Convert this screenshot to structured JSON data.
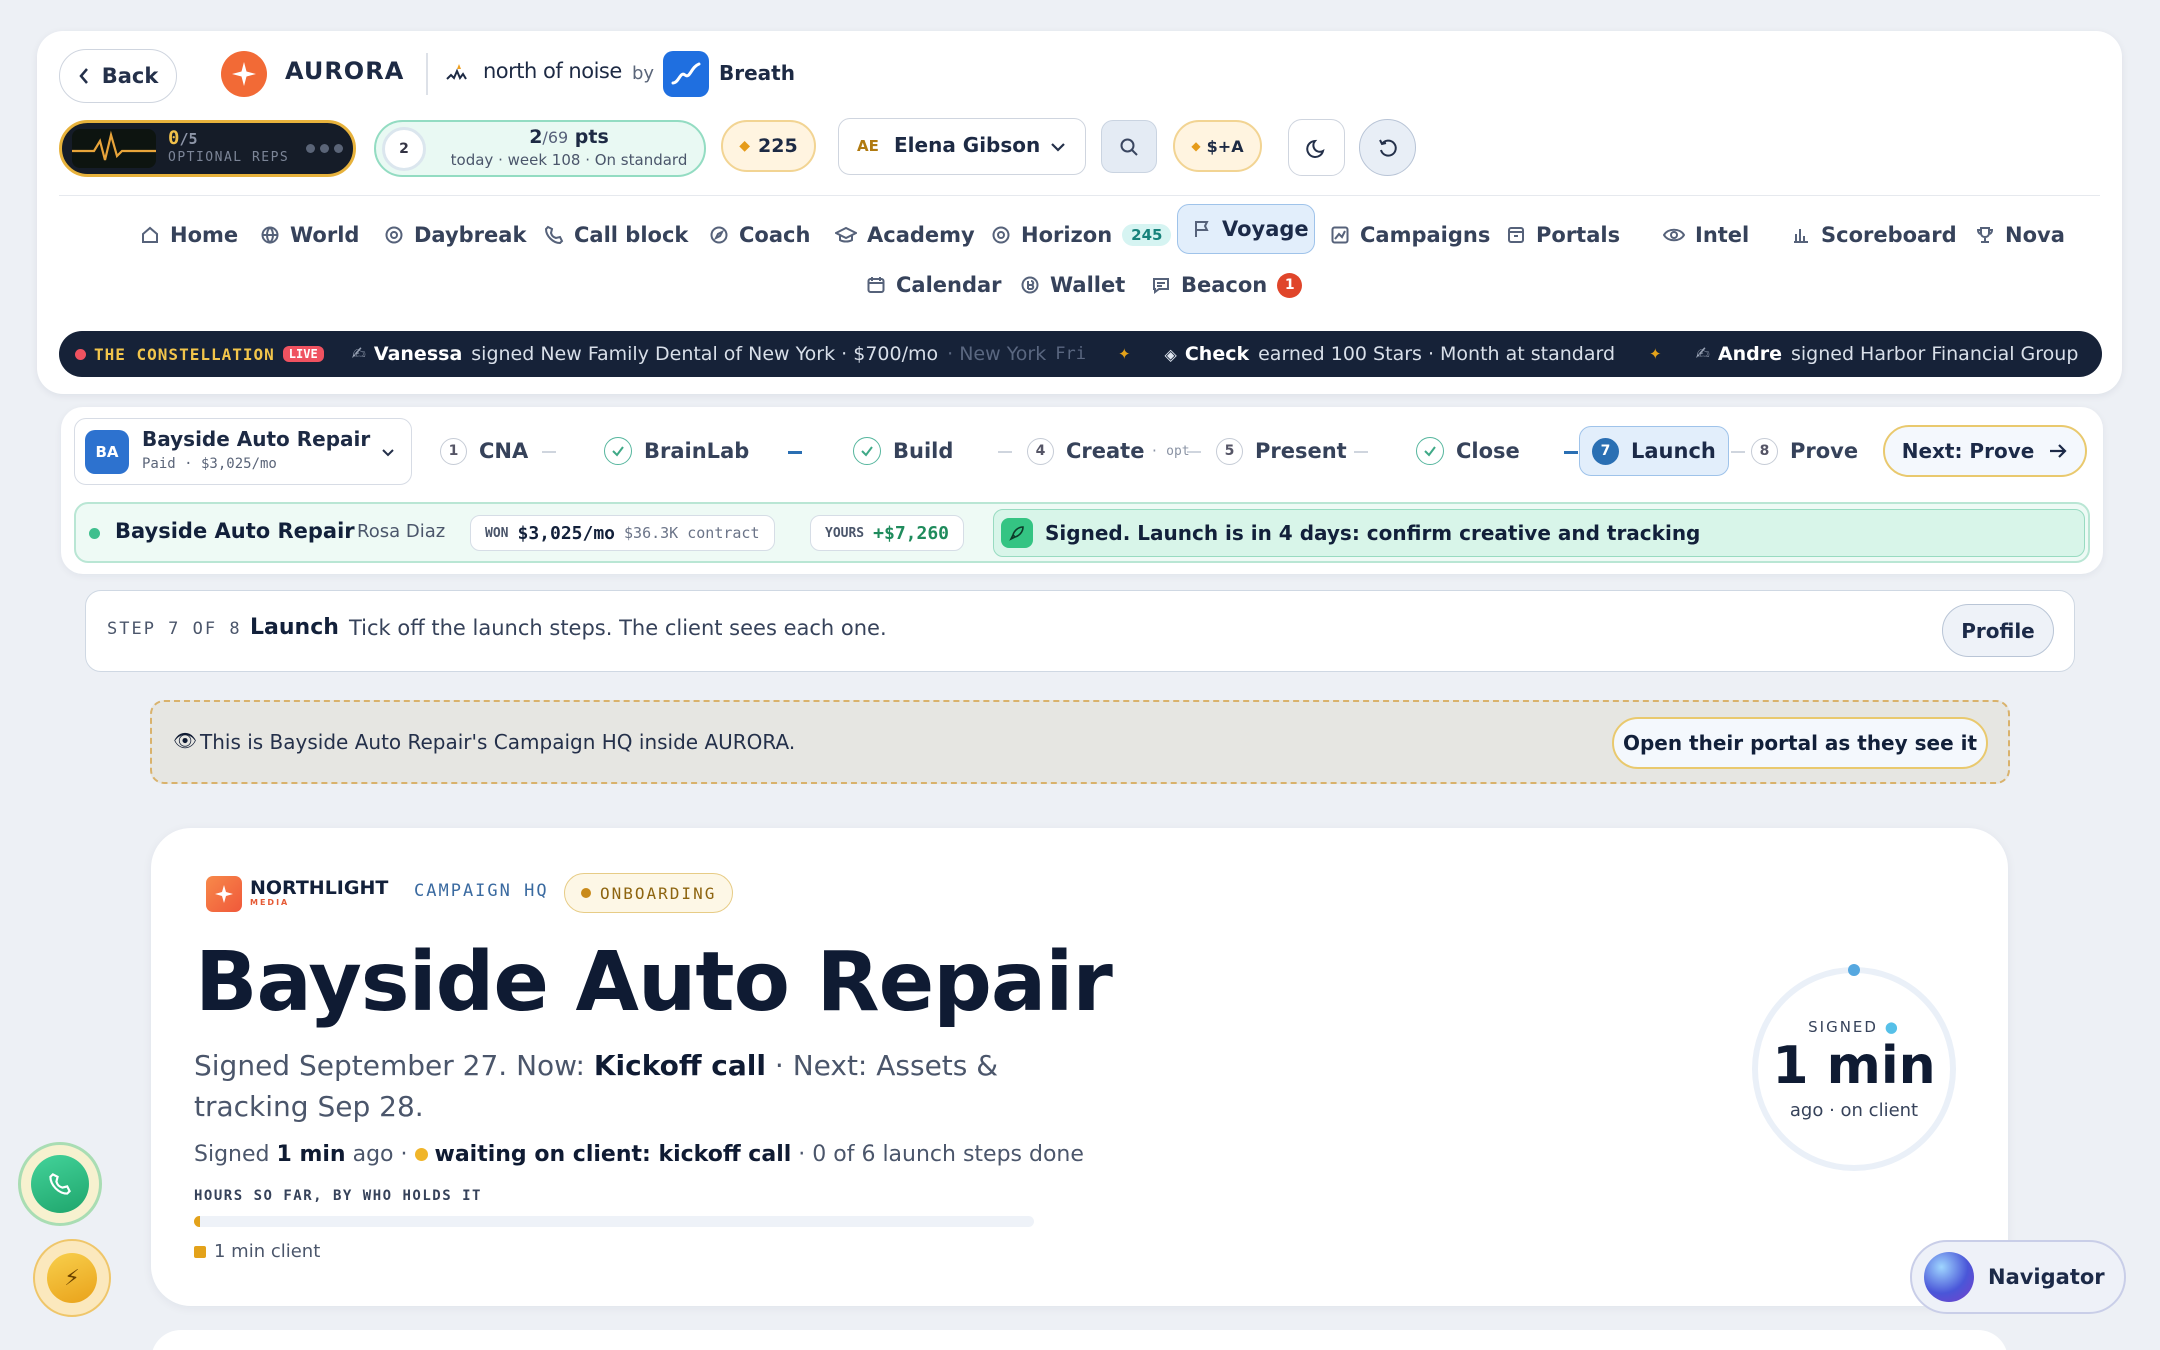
{
  "header": {
    "back_label": "Back",
    "brand_name": "AURORA",
    "partner_name": "north of noise",
    "by_label": "by",
    "breath_label": "Breath",
    "reps_count": "0",
    "reps_total": "/5",
    "reps_label": "OPTIONAL REPS",
    "pts_ring_value": "2",
    "pts_value": "2",
    "pts_total": "/69",
    "pts_unit": "pts",
    "pts_sub": "today · week 108 · On standard",
    "gems": "225",
    "user_initials": "AE",
    "user_name": "Elena Gibson",
    "grade_label": "$+A"
  },
  "nav": {
    "items": [
      {
        "label": "Home"
      },
      {
        "label": "World"
      },
      {
        "label": "Daybreak"
      },
      {
        "label": "Call block"
      },
      {
        "label": "Coach"
      },
      {
        "label": "Academy"
      },
      {
        "label": "Horizon",
        "count": "245"
      },
      {
        "label": "Voyage"
      },
      {
        "label": "Campaigns"
      },
      {
        "label": "Portals"
      },
      {
        "label": "Intel"
      },
      {
        "label": "Scoreboard"
      },
      {
        "label": "Nova"
      },
      {
        "label": "Calendar"
      },
      {
        "label": "Wallet"
      },
      {
        "label": "Beacon",
        "count": "1"
      }
    ]
  },
  "ticker": {
    "title": "THE CONSTELLATION",
    "live": "LIVE",
    "events": [
      {
        "name": "Vanessa",
        "text": "signed New Family Dental of New York · $700/mo",
        "meta": "· New York",
        "day": "Fri"
      },
      {
        "name": "Check",
        "text": "earned 100 Stars · Month at standard"
      },
      {
        "name": "Andre",
        "text": "signed Harbor Financial Group"
      }
    ]
  },
  "client": {
    "initials": "BA",
    "name": "Bayside Auto Repair",
    "status": "Paid · $3,025/mo",
    "contact": "Rosa Diaz",
    "won_label": "WON",
    "won_value": "$3,025/mo",
    "contract": "$36.3K contract",
    "yours_label": "YOURS",
    "yours_value": "+$7,260",
    "message": "Signed. Launch is in 4 days: confirm creative and tracking"
  },
  "stepper": {
    "steps": [
      {
        "num": "1",
        "label": "CNA"
      },
      {
        "num": "",
        "label": "BrainLab"
      },
      {
        "num": "",
        "label": "Build"
      },
      {
        "num": "4",
        "label": "Create",
        "tag": "· opt"
      },
      {
        "num": "5",
        "label": "Present"
      },
      {
        "num": "",
        "label": "Close"
      },
      {
        "num": "7",
        "label": "Launch"
      },
      {
        "num": "8",
        "label": "Prove"
      }
    ],
    "next_label": "Next: Prove"
  },
  "step_header": {
    "counter": "STEP 7 OF 8",
    "title": "Launch",
    "desc": "Tick off the launch steps. The client sees each one.",
    "profile_label": "Profile"
  },
  "notice": {
    "text": "This is Bayside Auto Repair's Campaign HQ inside AURORA.",
    "button": "Open their portal as they see it"
  },
  "hq": {
    "logo_name": "NORTHLIGHT",
    "logo_sub": "MEDIA",
    "label": "CAMPAIGN HQ",
    "status": "ONBOARDING",
    "title": "Bayside Auto Repair",
    "summary_prefix": "Signed September 27. Now:",
    "summary_now": "Kickoff call",
    "summary_next_a": "· Next: Assets &",
    "summary_next_b": "tracking Sep 28.",
    "signed_prefix": "Signed",
    "signed_value": "1 min",
    "signed_suffix": "ago ·",
    "waiting": "waiting on client: kickoff call",
    "progress_text": "· 0 of 6 launch steps done",
    "hours_label": "HOURS SO FAR, BY WHO HOLDS IT",
    "legend": "1 min client",
    "ring_label": "SIGNED",
    "ring_value": "1 min",
    "ring_sub": "ago · on client"
  },
  "floating": {
    "navigator": "Navigator"
  },
  "colors": {
    "accent": "#2a6fb3",
    "brand_orange": "#f26a36",
    "success": "#3fbf8e",
    "warning": "#e3a21a"
  }
}
